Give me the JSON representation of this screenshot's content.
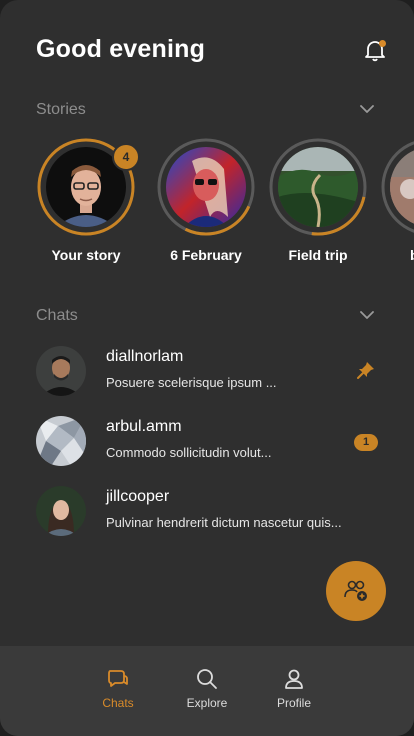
{
  "header": {
    "greeting": "Good evening",
    "notification_icon": "bell-icon"
  },
  "stories": {
    "section_title": "Stories",
    "items": [
      {
        "label": "Your story",
        "badge": "4"
      },
      {
        "label": "6 February"
      },
      {
        "label": "Field trip"
      },
      {
        "label": "b"
      }
    ]
  },
  "chats": {
    "section_title": "Chats",
    "items": [
      {
        "name": "diallnorlam",
        "message": "Posuere scelerisque ipsum ...",
        "pinned": true
      },
      {
        "name": "arbul.amm",
        "message": "Commodo sollicitudin volut...",
        "unread": "1"
      },
      {
        "name": "jillcooper",
        "message": "Pulvinar hendrerit dictum nascetur quis..."
      }
    ]
  },
  "fab": {
    "icon": "add-group-icon"
  },
  "tabbar": {
    "items": [
      {
        "label": "Chats",
        "icon": "chat-bubble-icon",
        "active": true
      },
      {
        "label": "Explore",
        "icon": "search-icon"
      },
      {
        "label": "Profile",
        "icon": "user-icon"
      }
    ]
  },
  "colors": {
    "accent": "#c98425",
    "background": "#2f2f2f",
    "tabbar": "#3a3a3a"
  }
}
